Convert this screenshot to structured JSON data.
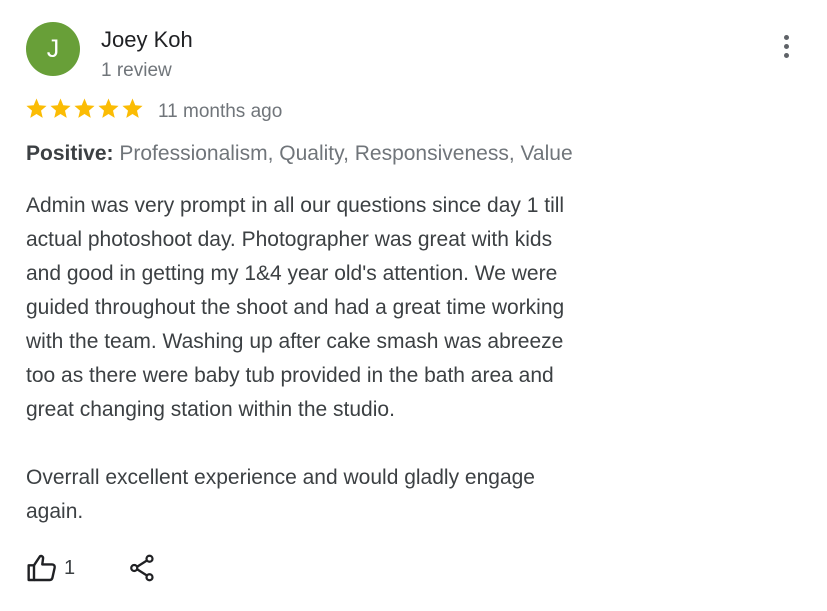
{
  "review": {
    "avatar_initial": "J",
    "avatar_color": "#689f38",
    "author": "Joey Koh",
    "review_count": "1 review",
    "rating": 5,
    "star_color": "#fbbc04",
    "time_ago": "11 months ago",
    "positive_label": "Positive:",
    "positive_values": "Professionalism, Quality, Responsiveness, Value",
    "body_paragraph_1": [
      "Admin was very prompt in all our questions since day 1 till",
      "actual photoshoot day. Photographer was great with kids",
      "and good in getting my 1&4 year old's attention. We were",
      "guided throughout the shoot and had a great time working",
      "with the team. Washing up after cake smash was abreeze",
      "too as there were baby tub provided in the bath area and",
      "great changing station within the studio."
    ],
    "body_paragraph_2": [
      "Overrall excellent experience and would gladly engage",
      "again."
    ],
    "like_count": "1"
  },
  "icons": {
    "more": "more-vert-icon",
    "star": "star-icon",
    "like": "thumbs-up-icon",
    "share": "share-icon"
  }
}
